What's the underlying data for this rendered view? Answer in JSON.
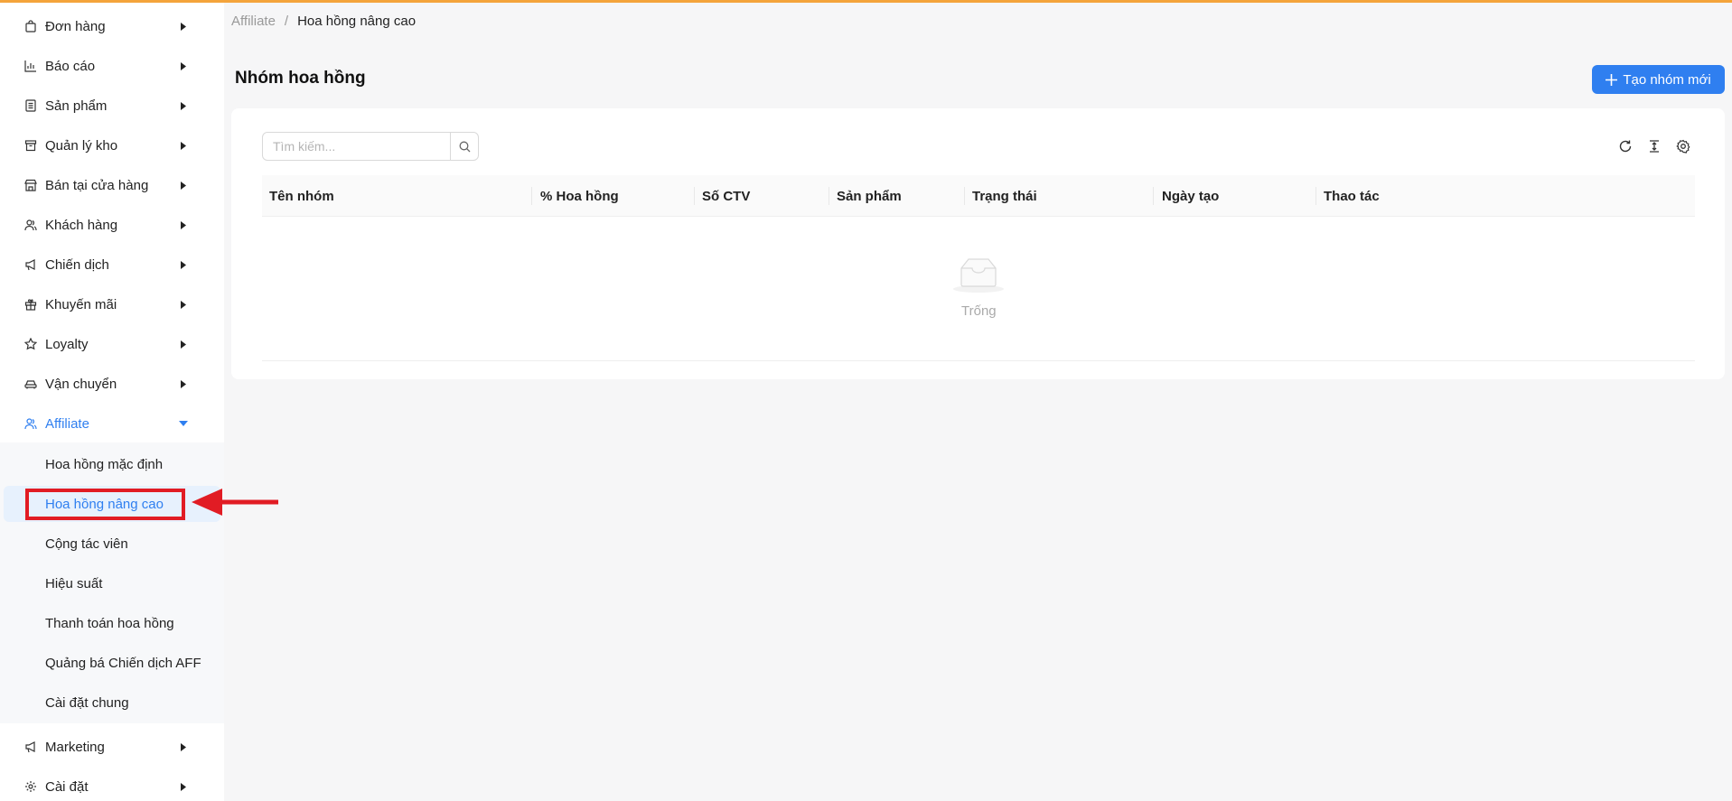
{
  "breadcrumb": {
    "parent": "Affiliate",
    "separator": "/",
    "current": "Hoa hồng nâng cao"
  },
  "page": {
    "title": "Nhóm hoa hồng",
    "create_button": "Tạo nhóm mới"
  },
  "search": {
    "placeholder": "Tìm kiếm..."
  },
  "sidebar": {
    "items": [
      {
        "label": "Đơn hàng",
        "icon": "bag-icon"
      },
      {
        "label": "Báo cáo",
        "icon": "chart-icon"
      },
      {
        "label": "Sản phẩm",
        "icon": "document-icon"
      },
      {
        "label": "Quản lý kho",
        "icon": "warehouse-icon"
      },
      {
        "label": "Bán tại cửa hàng",
        "icon": "store-icon"
      },
      {
        "label": "Khách hàng",
        "icon": "users-icon"
      },
      {
        "label": "Chiến dịch",
        "icon": "megaphone-icon"
      },
      {
        "label": "Khuyến mãi",
        "icon": "gift-icon"
      },
      {
        "label": "Loyalty",
        "icon": "star-icon"
      },
      {
        "label": "Vận chuyển",
        "icon": "car-icon"
      },
      {
        "label": "Affiliate",
        "icon": "affiliate-icon"
      }
    ],
    "affiliate_sub": [
      "Hoa hồng mặc định",
      "Hoa hồng nâng cao",
      "Cộng tác viên",
      "Hiệu suất",
      "Thanh toán hoa hồng",
      "Quảng bá Chiến dịch AFF",
      "Cài đặt chung"
    ],
    "bottom_items": [
      {
        "label": "Marketing",
        "icon": "megaphone-icon"
      },
      {
        "label": "Cài đặt",
        "icon": "gear-icon"
      }
    ]
  },
  "table": {
    "columns": [
      "Tên nhóm",
      "% Hoa hồng",
      "Số CTV",
      "Sản phẩm",
      "Trạng thái",
      "Ngày tạo",
      "Thao tác"
    ],
    "empty_text": "Trống"
  },
  "colors": {
    "accent": "#2f7ff0",
    "top_bar": "#f4a43b",
    "highlight": "#e11c24"
  }
}
